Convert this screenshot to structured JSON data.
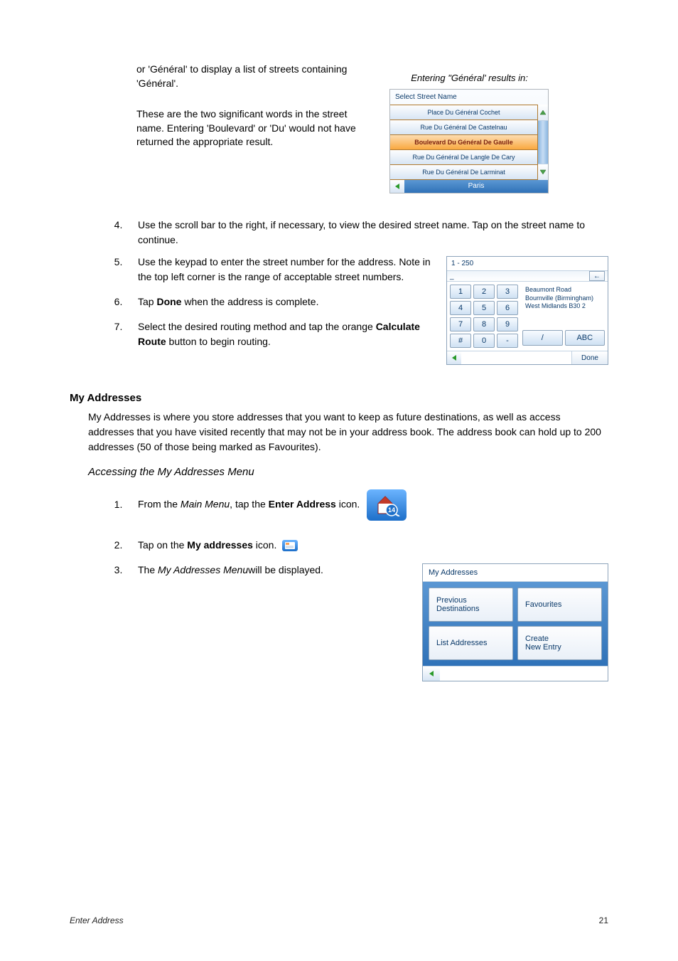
{
  "intro": {
    "p1": " or 'Général' to display a list of streets containing 'Général'.",
    "p2": "These are the two significant words in the street name. Entering 'Boulevard' or 'Du' would not have returned the appropriate result."
  },
  "streetUI": {
    "caption": "Entering \"Général' results in:",
    "header": "Select Street Name",
    "items": [
      "Place Du Général Cochet",
      "Rue Du Général De Castelnau",
      "Boulevard Du Général De Gaulle",
      "Rue Du Général De Langle De Cary",
      "Rue Du Général De Larminat"
    ],
    "selectedIndex": 2,
    "city": "Paris"
  },
  "steps1": [
    "Use the scroll bar to the right, if necessary, to view the desired street name.  Tap on the street name to continue.",
    "Use the keypad to enter the street number for the address.  Note in the top left corner is the range of acceptable street numbers.",
    "Tap Done when the address is complete.",
    "Select the desired routing method and tap the orange Calculate Route button to begin routing."
  ],
  "keypadUI": {
    "range": "1 - 250",
    "input": "_",
    "keys": [
      "1",
      "2",
      "3",
      "4",
      "5",
      "6",
      "7",
      "8",
      "9",
      "#",
      "0",
      "-"
    ],
    "address": [
      "Beaumont Road",
      "Bournville (Birmingham)",
      "West Midlands B30 2"
    ],
    "slash": "/",
    "abc": "ABC",
    "done": "Done"
  },
  "section": {
    "title": "My Addresses",
    "body": "My Addresses is where you store addresses that you want to keep as future destinations, as well as access addresses that you have visited recently that may not be in your address book.  The address book can hold up to 200 addresses (50 of those being marked as Favourites).",
    "subhead": "Accessing the My Addresses Menu"
  },
  "steps2": {
    "s1_pre": "From the ",
    "s1_ital": "Main Menu",
    "s1_mid": ", tap the ",
    "s1_bold": "Enter Address",
    "s1_post": " icon.",
    "s2_pre": "Tap on the ",
    "s2_bold": "My addresses",
    "s2_post": " icon.",
    "s3_pre": "The ",
    "s3_ital": "My Addresses Menu",
    "s3_post": "will be displayed."
  },
  "myAddrUI": {
    "header": "My Addresses",
    "buttons": [
      "Previous\nDestinations",
      "Favourites",
      "List Addresses",
      "Create\nNew Entry"
    ]
  },
  "footer": {
    "left": "Enter Address",
    "right": "21"
  },
  "boldWords": {
    "done": "Done",
    "calc": "Calculate Route"
  }
}
